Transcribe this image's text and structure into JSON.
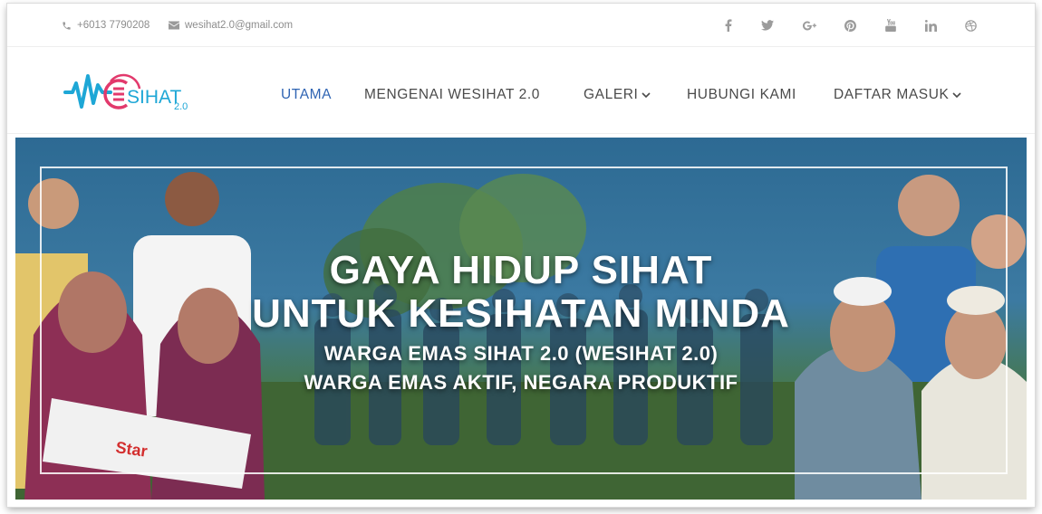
{
  "topbar": {
    "phone": "+6013 7790208",
    "email": "wesihat2.0@gmail.com",
    "social_icons": [
      "facebook-icon",
      "twitter-icon",
      "google-plus-icon",
      "pinterest-icon",
      "youtube-icon",
      "linkedin-icon",
      "dribbble-icon"
    ]
  },
  "logo": {
    "main": "SIHAT",
    "suffix": "2.0"
  },
  "nav": {
    "items": [
      {
        "label": "UTAMA",
        "active": true
      },
      {
        "label": "MENGENAI WESIHAT 2.0",
        "active": false
      },
      {
        "label": "GALERI",
        "active": false,
        "dropdown": true
      },
      {
        "label": "HUBUNGI KAMI",
        "active": false
      },
      {
        "label": "DAFTAR MASUK",
        "active": false,
        "dropdown": true
      }
    ]
  },
  "hero": {
    "line1": "GAYA HIDUP SIHAT",
    "line2": "UNTUK KESIHATAN MINDA",
    "line3": "WARGA EMAS SIHAT 2.0 (WESIHAT 2.0)",
    "line4": "WARGA EMAS AKTIF, NEGARA PRODUKTIF",
    "newspaper_text": "Star"
  },
  "colors": {
    "accent_blue": "#2f64b3",
    "logo_cyan": "#1ea7d6",
    "logo_pink": "#e2396c"
  }
}
